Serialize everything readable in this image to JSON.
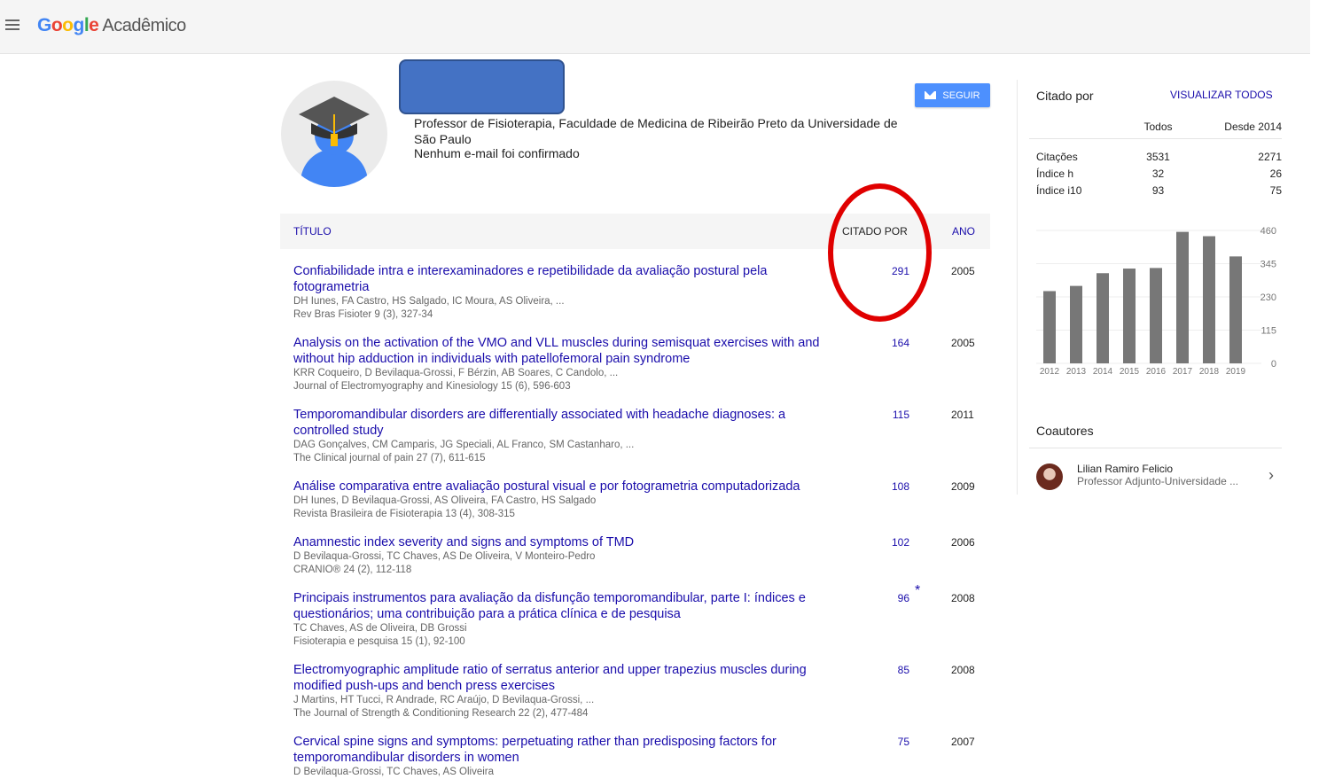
{
  "header": {
    "logo_g": "G",
    "logo_o1": "o",
    "logo_o2": "o",
    "logo_g2": "g",
    "logo_l": "l",
    "logo_e": "e",
    "logo_suffix": "Acadêmico"
  },
  "profile": {
    "affiliation": "Professor de Fisioterapia, Faculdade de Medicina de Ribeirão Preto da Universidade de São Paulo",
    "email_status": "Nenhum e-mail foi confirmado",
    "follow_label": "SEGUIR"
  },
  "table": {
    "col_title": "TÍTULO",
    "col_cited": "CITADO POR",
    "col_year": "ANO",
    "rows": [
      {
        "title": "Confiabilidade intra e interexaminadores e repetibilidade da avaliação postural pela fotogrametria",
        "authors": "DH Iunes, FA Castro, HS Salgado, IC Moura, AS Oliveira, ...",
        "venue": "Rev Bras Fisioter 9 (3), 327-34",
        "cited": "291",
        "year": "2005"
      },
      {
        "title": "Analysis on the activation of the VMO and VLL muscles during semisquat exercises with and without hip adduction in individuals with patellofemoral pain syndrome",
        "authors": "KRR Coqueiro, D Bevilaqua-Grossi, F Bérzin, AB Soares, C Candolo, ...",
        "venue": "Journal of Electromyography and Kinesiology 15 (6), 596-603",
        "cited": "164",
        "year": "2005"
      },
      {
        "title": "Temporomandibular disorders are differentially associated with headache diagnoses: a controlled study",
        "authors": "DAG Gonçalves, CM Camparis, JG Speciali, AL Franco, SM Castanharo, ...",
        "venue": "The Clinical journal of pain 27 (7), 611-615",
        "cited": "115",
        "year": "2011"
      },
      {
        "title": "Análise comparativa entre avaliação postural visual e por fotogrametria computadorizada",
        "authors": "DH Iunes, D Bevilaqua-Grossi, AS Oliveira, FA Castro, HS Salgado",
        "venue": "Revista Brasileira de Fisioterapia 13 (4), 308-315",
        "cited": "108",
        "year": "2009"
      },
      {
        "title": "Anamnestic index severity and signs and symptoms of TMD",
        "authors": "D Bevilaqua-Grossi, TC Chaves, AS De Oliveira, V Monteiro-Pedro",
        "venue": "CRANIO® 24 (2), 112-118",
        "cited": "102",
        "year": "2006"
      },
      {
        "title": "Principais instrumentos para avaliação da disfunção temporomandibular, parte I: índices e questionários; uma contribuição para a prática clínica e de pesquisa",
        "authors": "TC Chaves, AS de Oliveira, DB Grossi",
        "venue": "Fisioterapia e pesquisa 15 (1), 92-100",
        "cited": "96",
        "star": "*",
        "year": "2008"
      },
      {
        "title": "Electromyographic amplitude ratio of serratus anterior and upper trapezius muscles during modified push-ups and bench press exercises",
        "authors": "J Martins, HT Tucci, R Andrade, RC Araújo, D Bevilaqua-Grossi, ...",
        "venue": "The Journal of Strength & Conditioning Research 22 (2), 477-484",
        "cited": "85",
        "year": "2008"
      },
      {
        "title": "Cervical spine signs and symptoms: perpetuating rather than predisposing factors for temporomandibular disorders in women",
        "authors": "D Bevilaqua-Grossi, TC Chaves, AS Oliveira",
        "venue": "",
        "cited": "75",
        "year": "2007"
      }
    ]
  },
  "sidebar": {
    "cited_by": "Citado por",
    "view_all": "VISUALIZAR TODOS",
    "col_all": "Todos",
    "col_since": "Desde 2014",
    "stats": [
      {
        "label": "Citações",
        "all": "3531",
        "since": "2271"
      },
      {
        "label": "Índice h",
        "all": "32",
        "since": "26"
      },
      {
        "label": "Índice i10",
        "all": "93",
        "since": "75"
      }
    ],
    "coauthors_heading": "Coautores",
    "coauthors": [
      {
        "name": "Lilian Ramiro Felicio",
        "affiliation": "Professor Adjunto-Universidade ..."
      }
    ]
  },
  "colors": {
    "link": "#1a0dab",
    "follow_button": "#4d90fe",
    "bar": "#777777",
    "highlight_circle": "#e00000"
  },
  "chart_data": {
    "type": "bar",
    "categories": [
      "2012",
      "2013",
      "2014",
      "2015",
      "2016",
      "2017",
      "2018",
      "2019"
    ],
    "values": [
      250,
      268,
      312,
      328,
      330,
      455,
      440,
      370
    ],
    "yticks": [
      "0",
      "115",
      "230",
      "345",
      "460"
    ],
    "ylim": [
      0,
      460
    ],
    "grid": true
  }
}
